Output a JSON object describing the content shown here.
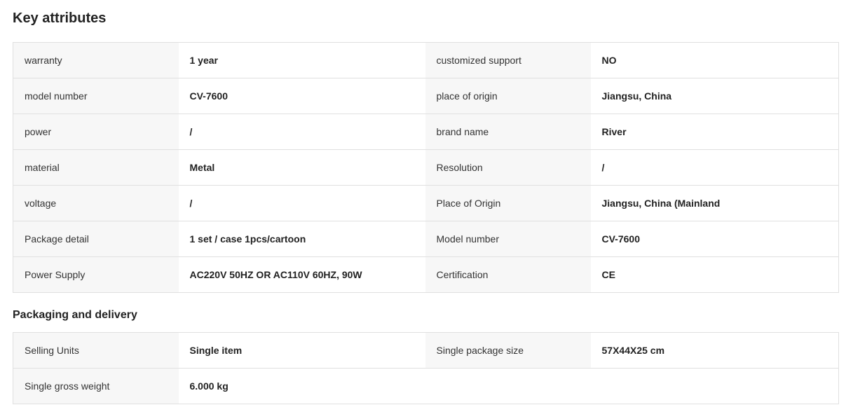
{
  "key_attributes": {
    "title": "Key attributes",
    "rows": [
      {
        "k1": "warranty",
        "v1": "1 year",
        "k2": "customized support",
        "v2": "NO"
      },
      {
        "k1": "model number",
        "v1": "CV-7600",
        "k2": "place of origin",
        "v2": "Jiangsu, China"
      },
      {
        "k1": "power",
        "v1": "/",
        "k2": "brand name",
        "v2": "River"
      },
      {
        "k1": "material",
        "v1": "Metal",
        "k2": "Resolution",
        "v2": "/"
      },
      {
        "k1": "voltage",
        "v1": "/",
        "k2": "Place of Origin",
        "v2": "Jiangsu, China (Mainland"
      },
      {
        "k1": "Package detail",
        "v1": "1 set / case 1pcs/cartoon",
        "k2": "Model number",
        "v2": "CV-7600"
      },
      {
        "k1": "Power Supply",
        "v1": "AC220V 50HZ OR AC110V 60HZ, 90W",
        "k2": "Certification",
        "v2": "CE"
      }
    ]
  },
  "packaging": {
    "title": "Packaging and delivery",
    "rows": [
      {
        "k1": "Selling Units",
        "v1": "Single item",
        "k2": "Single package size",
        "v2": "57X44X25 cm"
      },
      {
        "k1": "Single gross weight",
        "v1": "6.000 kg"
      }
    ]
  }
}
